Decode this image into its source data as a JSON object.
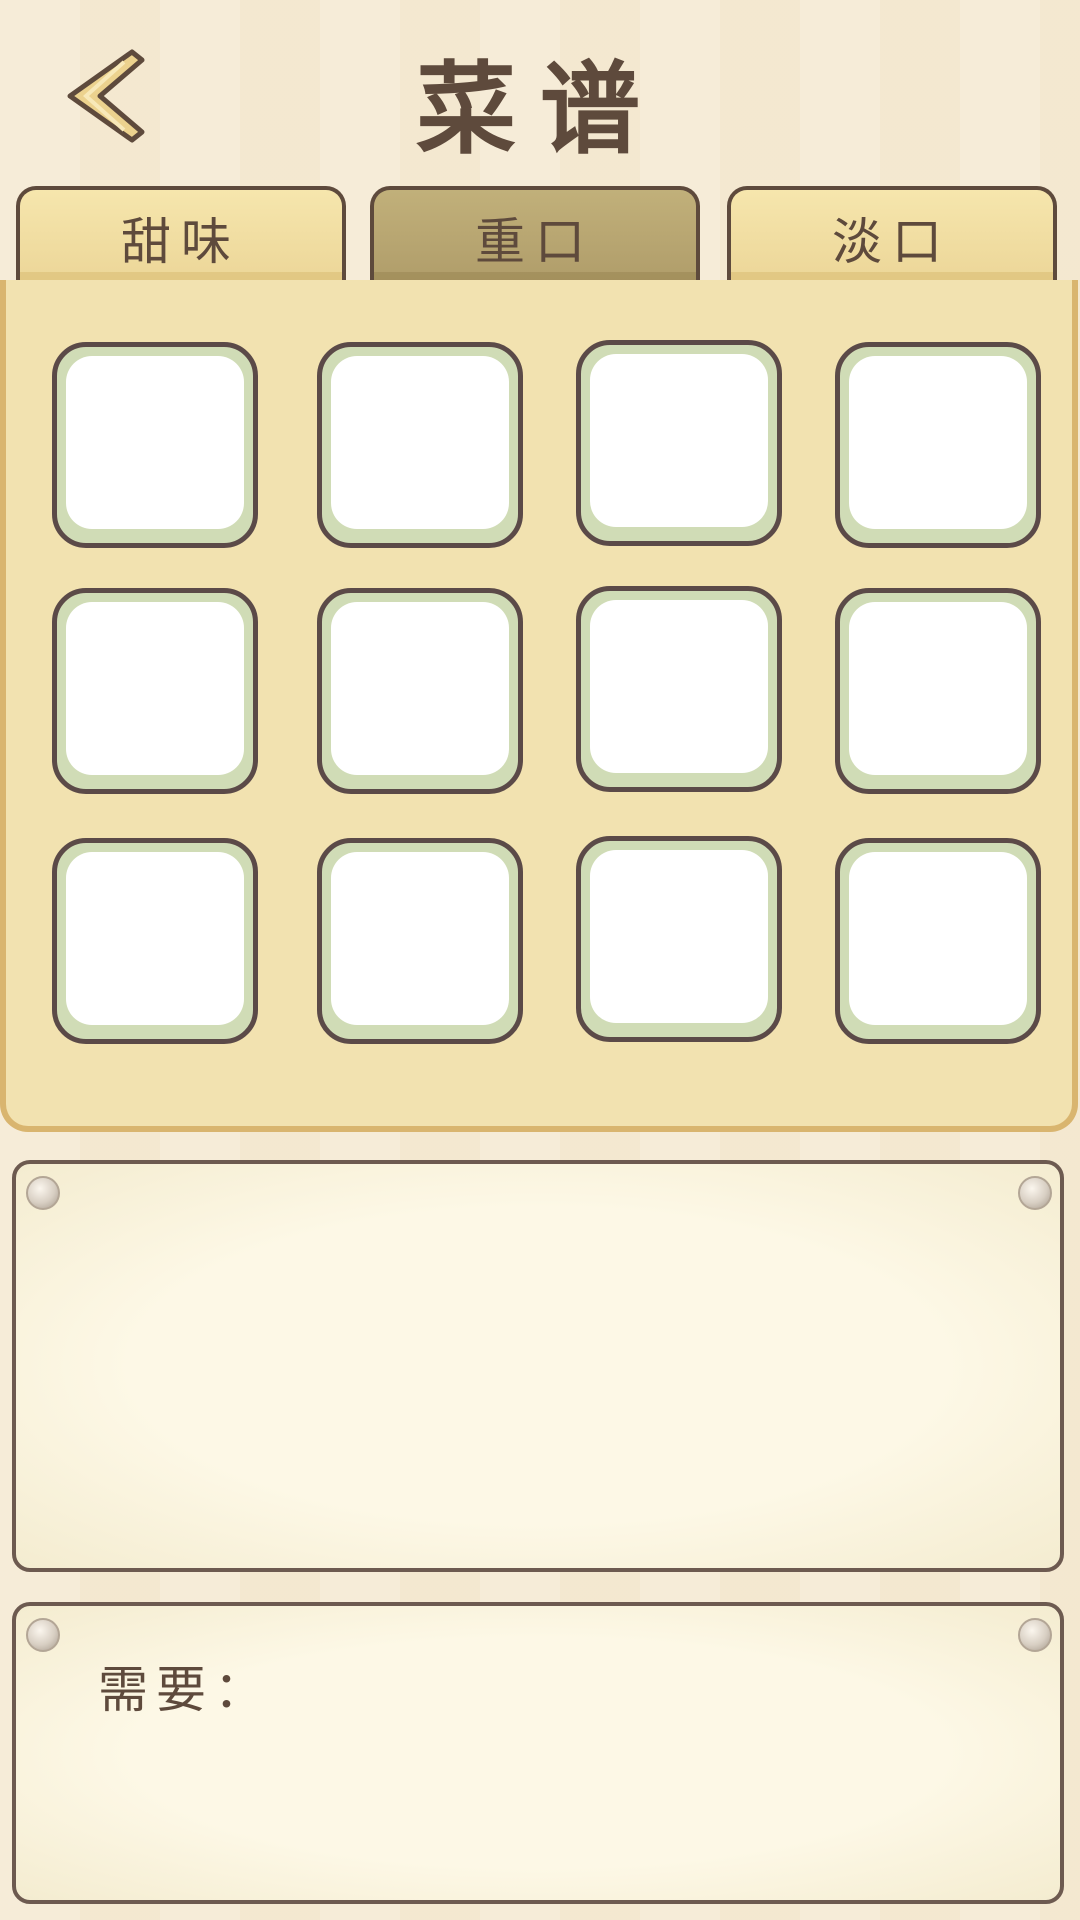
{
  "header": {
    "title": "菜谱",
    "back_icon": "chevron-left-icon"
  },
  "tabs": [
    {
      "label": "甜味",
      "active": false
    },
    {
      "label": "重口",
      "active": true
    },
    {
      "label": "淡口",
      "active": false
    }
  ],
  "recipe_grid": {
    "rows": 3,
    "columns": 4,
    "slots": [
      "",
      "",
      "",
      "",
      "",
      "",
      "",
      "",
      "",
      "",
      "",
      ""
    ]
  },
  "description_card": {
    "text": ""
  },
  "requirements_card": {
    "label": "需要："
  },
  "colors": {
    "background": "#f5ead4",
    "panel": "#f2e2b0",
    "tab": "#f6e6ad",
    "tab_active": "#b8a572",
    "slot_border": "#5b4a48",
    "slot_frame": "#d0dcb6",
    "text": "#5e4a3c"
  }
}
